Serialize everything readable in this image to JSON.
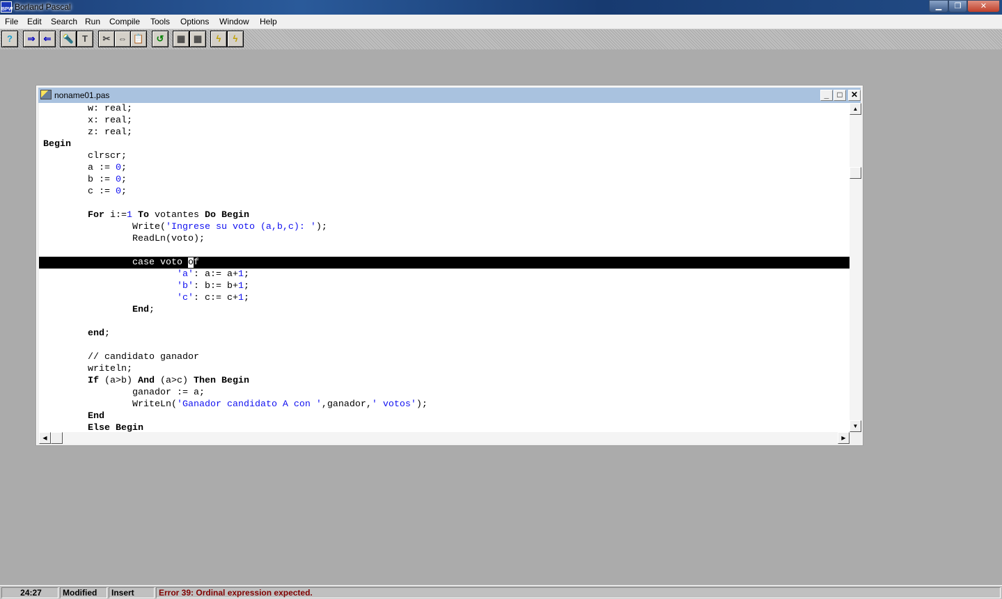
{
  "app": {
    "title": "Borland Pascal",
    "icon": "bpw-logo-icon"
  },
  "window_controls": {
    "minimize": "minimize-icon",
    "maximize": "maximize-icon",
    "close": "close-icon"
  },
  "menu": [
    "File",
    "Edit",
    "Search",
    "Run",
    "Compile",
    "Tools",
    "Options",
    "Window",
    "Help"
  ],
  "toolbar": [
    {
      "name": "help-icon",
      "glyph": "?"
    },
    {
      "name": "save-file-icon",
      "glyph": "⇒"
    },
    {
      "name": "open-file-icon",
      "glyph": "⇐"
    },
    {
      "name": "find-icon",
      "glyph": "🔦"
    },
    {
      "name": "find-text-icon",
      "glyph": "T"
    },
    {
      "name": "cut-icon",
      "glyph": "✂"
    },
    {
      "name": "copy-icon",
      "glyph": "⇔"
    },
    {
      "name": "paste-icon",
      "glyph": "📋"
    },
    {
      "name": "undo-icon",
      "glyph": "↺"
    },
    {
      "name": "compile-icon",
      "glyph": "▦"
    },
    {
      "name": "make-icon",
      "glyph": "▦"
    },
    {
      "name": "run-icon",
      "glyph": "ϟ"
    },
    {
      "name": "debug-run-icon",
      "glyph": "ϟ"
    }
  ],
  "editor": {
    "title": "noname01.pas",
    "code": [
      [
        [
          "        w: real;",
          ""
        ]
      ],
      [
        [
          "        x: real;",
          ""
        ]
      ],
      [
        [
          "        z: real;",
          ""
        ]
      ],
      [
        [
          "Begin",
          "k"
        ]
      ],
      [
        [
          "        clrscr;",
          ""
        ]
      ],
      [
        [
          "        a := ",
          ""
        ],
        [
          "0",
          "n"
        ],
        [
          ";",
          ""
        ]
      ],
      [
        [
          "        b := ",
          ""
        ],
        [
          "0",
          "n"
        ],
        [
          ";",
          ""
        ]
      ],
      [
        [
          "        c := ",
          ""
        ],
        [
          "0",
          "n"
        ],
        [
          ";",
          ""
        ]
      ],
      [],
      [
        [
          "        ",
          ""
        ],
        [
          "For",
          "k"
        ],
        [
          " i:=",
          ""
        ],
        [
          "1",
          "n"
        ],
        [
          " ",
          ""
        ],
        [
          "To",
          "k"
        ],
        [
          " votantes ",
          ""
        ],
        [
          "Do",
          "k"
        ],
        [
          " ",
          ""
        ],
        [
          "Begin",
          "k"
        ]
      ],
      [
        [
          "                Write(",
          ""
        ],
        [
          "'Ingrese su voto (a,b,c): '",
          "s"
        ],
        [
          ");",
          ""
        ]
      ],
      [
        [
          "                ReadLn(voto);",
          ""
        ]
      ],
      [],
      [
        [
          "                case voto ",
          ""
        ],
        [
          "o",
          "cur"
        ],
        [
          "f",
          ""
        ]
      ],
      [
        [
          "                        ",
          ""
        ],
        [
          "'a'",
          "s"
        ],
        [
          ": a:= a+",
          ""
        ],
        [
          "1",
          "n"
        ],
        [
          ";",
          ""
        ]
      ],
      [
        [
          "                        ",
          ""
        ],
        [
          "'b'",
          "s"
        ],
        [
          ": b:= b+",
          ""
        ],
        [
          "1",
          "n"
        ],
        [
          ";",
          ""
        ]
      ],
      [
        [
          "                        ",
          ""
        ],
        [
          "'c'",
          "s"
        ],
        [
          ": c:= c+",
          ""
        ],
        [
          "1",
          "n"
        ],
        [
          ";",
          ""
        ]
      ],
      [
        [
          "                ",
          ""
        ],
        [
          "End",
          "k"
        ],
        [
          ";",
          ""
        ]
      ],
      [],
      [
        [
          "        ",
          ""
        ],
        [
          "end",
          "k"
        ],
        [
          ";",
          ""
        ]
      ],
      [],
      [
        [
          "        // candidato ganador",
          ""
        ]
      ],
      [
        [
          "        writeln;",
          ""
        ]
      ],
      [
        [
          "        ",
          ""
        ],
        [
          "If",
          "k"
        ],
        [
          " (a>b) ",
          ""
        ],
        [
          "And",
          "k"
        ],
        [
          " (a>c) ",
          ""
        ],
        [
          "Then",
          "k"
        ],
        [
          " ",
          ""
        ],
        [
          "Begin",
          "k"
        ]
      ],
      [
        [
          "                ganador := a;",
          ""
        ]
      ],
      [
        [
          "                WriteLn(",
          ""
        ],
        [
          "'Ganador candidato A con '",
          "s"
        ],
        [
          ",ganador,",
          ""
        ],
        [
          "' votos'",
          "s"
        ],
        [
          ");",
          ""
        ]
      ],
      [
        [
          "        ",
          ""
        ],
        [
          "End",
          "k"
        ]
      ],
      [
        [
          "        ",
          ""
        ],
        [
          "Else",
          "k"
        ],
        [
          " ",
          ""
        ],
        [
          "Begin",
          "k"
        ]
      ]
    ],
    "highlighted_line": 13
  },
  "status": {
    "position": "24:27",
    "modified": "Modified",
    "mode": "Insert",
    "message": "Error 39: Ordinal expression expected.",
    "message_color": "#800000"
  }
}
